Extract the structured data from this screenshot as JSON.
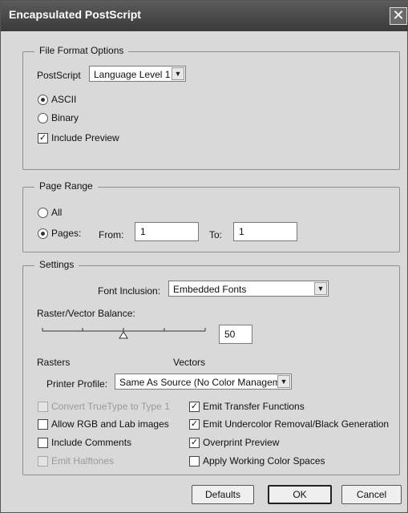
{
  "window": {
    "title": "Encapsulated PostScript",
    "close_glyph": "✕"
  },
  "file_format": {
    "legend": "File Format Options",
    "postscript_label": "PostScript",
    "postscript_value": "Language Level 1",
    "ascii_label": "ASCII",
    "binary_label": "Binary",
    "include_preview_label": "Include Preview",
    "encoding_selected": "ASCII",
    "include_preview": true
  },
  "page_range": {
    "legend": "Page Range",
    "all_label": "All",
    "pages_label": "Pages:",
    "from_label": "From:",
    "from_value": "1",
    "to_label": "To:",
    "to_value": "1",
    "selected": "Pages"
  },
  "settings": {
    "legend": "Settings",
    "font_inclusion_label": "Font Inclusion:",
    "font_inclusion_value": "Embedded Fonts",
    "balance_label": "Raster/Vector Balance:",
    "balance_value": "50",
    "rasters_label": "Rasters",
    "vectors_label": "Vectors",
    "printer_profile_label": "Printer Profile:",
    "printer_profile_value": "Same As Source (No Color Managem..",
    "left_options": [
      {
        "label": "Convert TrueType to Type 1",
        "checked": false,
        "enabled": false
      },
      {
        "label": "Allow RGB and Lab images",
        "checked": false,
        "enabled": true
      },
      {
        "label": "Include Comments",
        "checked": false,
        "enabled": true
      },
      {
        "label": "Emit Halftones",
        "checked": false,
        "enabled": false
      }
    ],
    "right_options": [
      {
        "label": "Emit Transfer Functions",
        "checked": true,
        "enabled": true
      },
      {
        "label": "Emit Undercolor Removal/Black Generation",
        "checked": true,
        "enabled": true
      },
      {
        "label": "Overprint Preview",
        "checked": true,
        "enabled": true
      },
      {
        "label": "Apply Working Color Spaces",
        "checked": false,
        "enabled": true
      }
    ]
  },
  "buttons": {
    "defaults": "Defaults",
    "ok": "OK",
    "cancel": "Cancel"
  },
  "icons": {
    "dropdown": "chevron-down-icon",
    "check": "✓"
  }
}
